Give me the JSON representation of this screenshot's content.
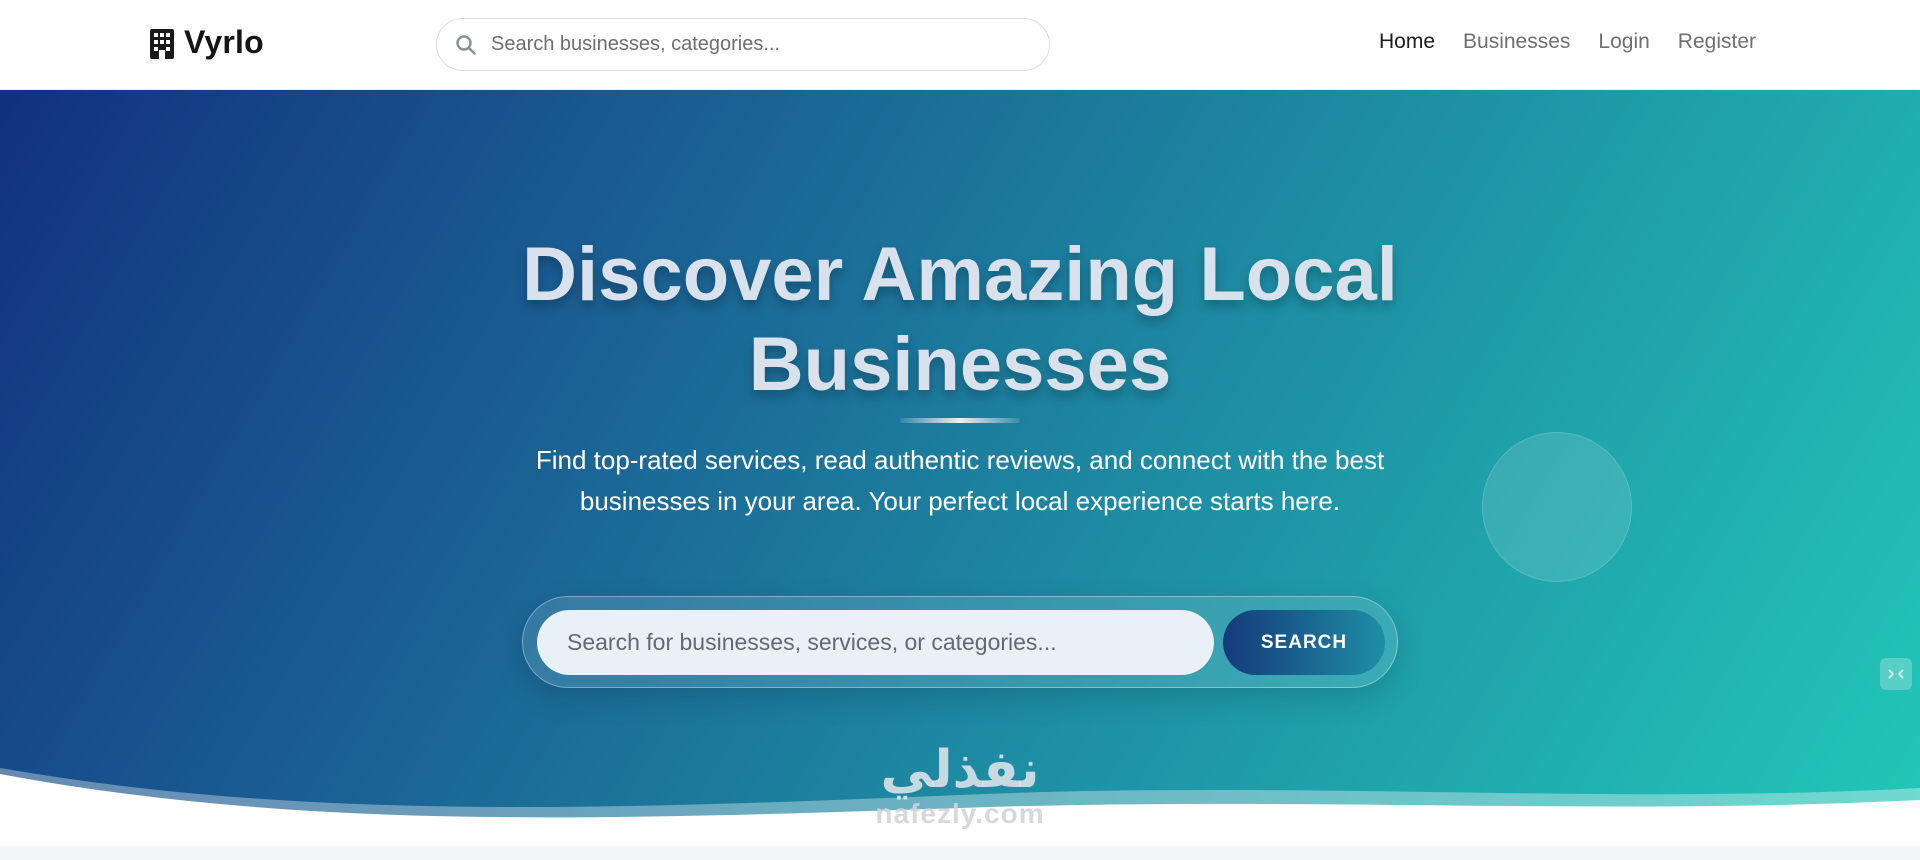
{
  "header": {
    "brand": "Vyrlo",
    "search_placeholder": "Search businesses, categories...",
    "nav": [
      {
        "label": "Home",
        "active": true
      },
      {
        "label": "Businesses",
        "active": false
      },
      {
        "label": "Login",
        "active": false
      },
      {
        "label": "Register",
        "active": false
      }
    ]
  },
  "hero": {
    "title_line1": "Discover Amazing Local",
    "title_line2": "Businesses",
    "subtitle": "Find top-rated services, read authentic reviews, and connect with the best businesses in your area. Your perfect local experience starts here.",
    "search_placeholder": "Search for businesses, services, or categories...",
    "search_button": "SEARCH"
  },
  "watermark": {
    "arabic": "نفذلي",
    "latin": "nafezly.com"
  },
  "colors": {
    "gradient_start": "#12317f",
    "gradient_end": "#22c8b8",
    "active_nav": "#1d1d1d",
    "nav": "#707070"
  },
  "icons": {
    "brand": "building-icon",
    "search": "search-icon",
    "chat": "chat-widget-icon"
  }
}
